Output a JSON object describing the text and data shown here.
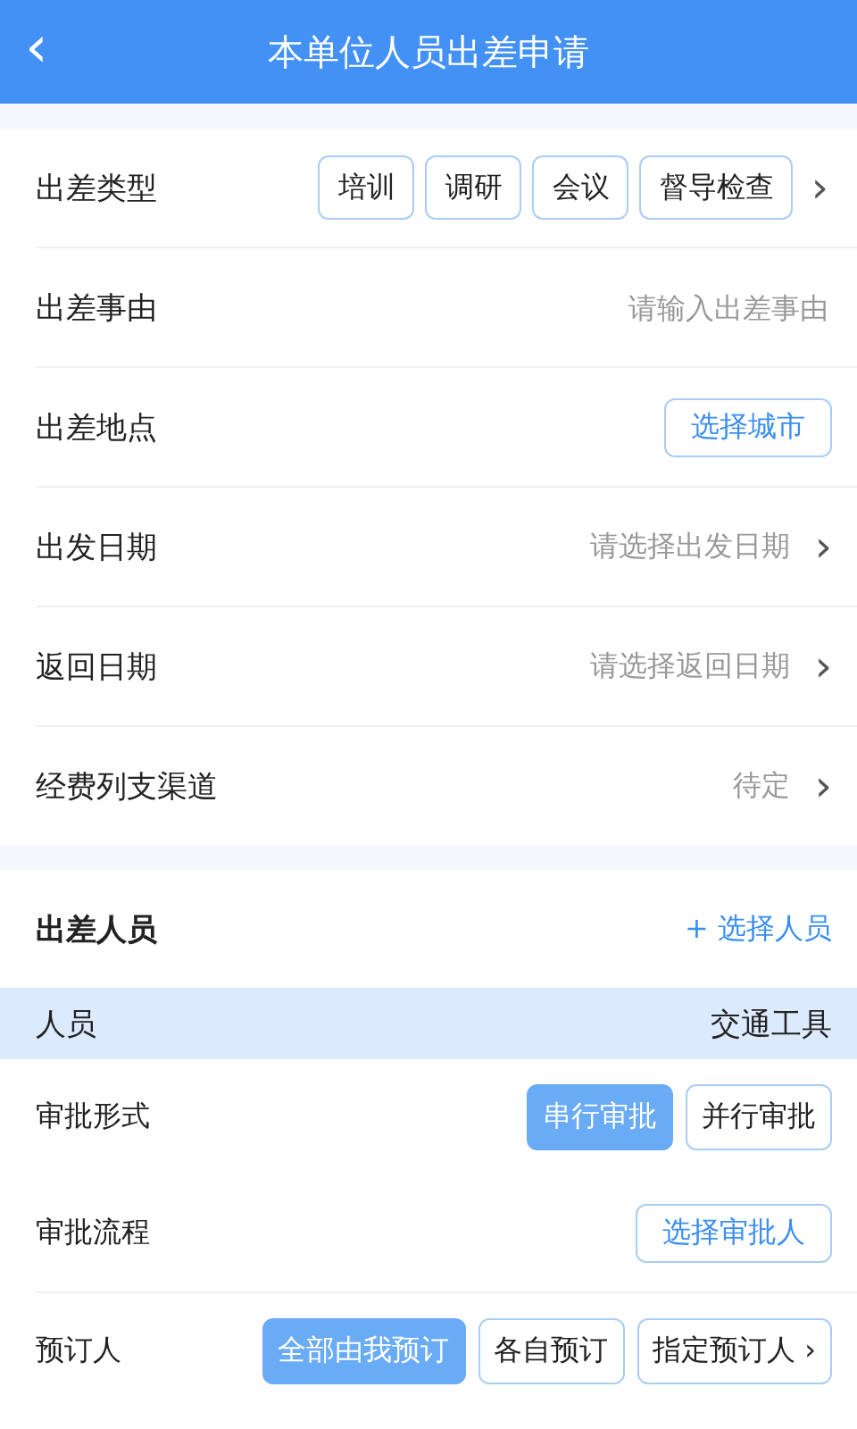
{
  "header": {
    "back": "‹",
    "title": "本单位人员出差申请"
  },
  "form": [
    {
      "kind": "chips",
      "label": "出差类型",
      "options": [
        {
          "label": "培训",
          "selected": false
        },
        {
          "label": "调研",
          "selected": false
        },
        {
          "label": "会议",
          "selected": false
        },
        {
          "label": "督导检查",
          "selected": false
        }
      ],
      "chevron": "›"
    },
    {
      "kind": "input",
      "label": "出差事由",
      "placeholder": "请输入出差事由"
    },
    {
      "kind": "button",
      "label": "出差地点",
      "button": "选择城市"
    },
    {
      "kind": "select",
      "label": "出发日期",
      "placeholder": "请选择出发日期",
      "chevron": "›"
    },
    {
      "kind": "select",
      "label": "返回日期",
      "placeholder": "请选择返回日期",
      "chevron": "›"
    },
    {
      "kind": "select",
      "label": "经费列支渠道",
      "value": "待定",
      "chevron": "›"
    }
  ],
  "travelers": {
    "title": "出差人员",
    "action": "+ 选择人员",
    "columns": [
      "人员",
      "交通工具"
    ]
  },
  "approval": [
    {
      "kind": "toggle",
      "label": "审批形式",
      "options": [
        {
          "label": "串行审批",
          "selected": true
        },
        {
          "label": "并行审批",
          "selected": false
        }
      ]
    },
    {
      "kind": "button",
      "label": "审批流程",
      "button": "选择审批人"
    },
    {
      "kind": "toggle",
      "label": "预订人",
      "options": [
        {
          "label": "全部由我预订",
          "selected": true
        },
        {
          "label": "各自预订",
          "selected": false
        },
        {
          "label": "指定预订人 ›",
          "selected": false
        }
      ]
    }
  ]
}
